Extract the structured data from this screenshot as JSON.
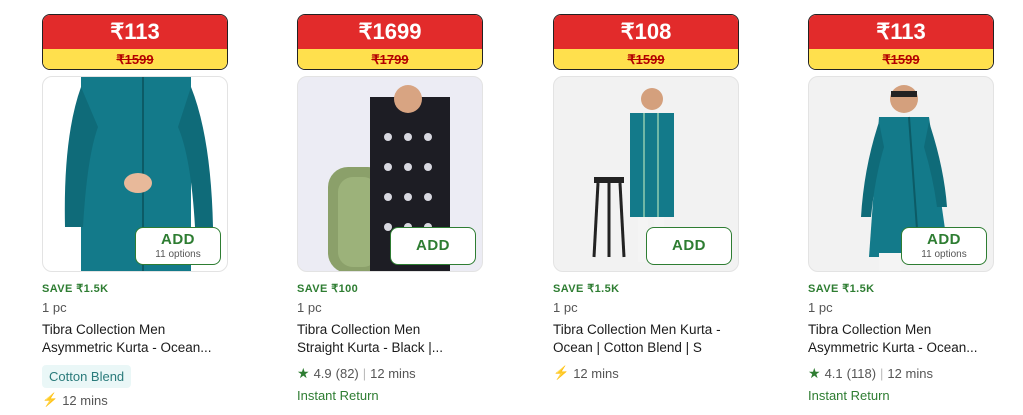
{
  "products": [
    {
      "price": "₹113",
      "mrp": "₹1599",
      "add_label": "ADD",
      "options": "11 options",
      "save": "SAVE ₹1.5K",
      "qty": "1 pc",
      "title_line1": "Tibra Collection Men",
      "title_line2": "Asymmetric Kurta - Ocean...",
      "chip": "Cotton Blend",
      "eta": "12 mins"
    },
    {
      "price": "₹1699",
      "mrp": "₹1799",
      "add_label": "ADD",
      "save": "SAVE ₹100",
      "qty": "1 pc",
      "title_line1": "Tibra Collection Men",
      "title_line2": "Straight Kurta - Black |...",
      "rating": "4.9",
      "reviews": "(82)",
      "eta": "12 mins",
      "returns": "Instant Return"
    },
    {
      "price": "₹108",
      "mrp": "₹1599",
      "add_label": "ADD",
      "save": "SAVE ₹1.5K",
      "qty": "1 pc",
      "title_line1": "Tibra Collection Men Kurta -",
      "title_line2": "Ocean | Cotton Blend | S",
      "eta": "12 mins"
    },
    {
      "price": "₹113",
      "mrp": "₹1599",
      "add_label": "ADD",
      "options": "11 options",
      "save": "SAVE ₹1.5K",
      "qty": "1 pc",
      "title_line1": "Tibra Collection Men",
      "title_line2": "Asymmetric Kurta - Ocean...",
      "rating": "4.1",
      "reviews": "(118)",
      "eta": "12 mins",
      "returns": "Instant Return"
    }
  ],
  "colors": {
    "price_red": "#e22b2b",
    "mrp_yellow": "#ffe04d",
    "green": "#2e7d32",
    "kurta_teal": "#137a8a"
  },
  "icons": {
    "star": "star-icon",
    "bolt": "lightning-icon"
  }
}
